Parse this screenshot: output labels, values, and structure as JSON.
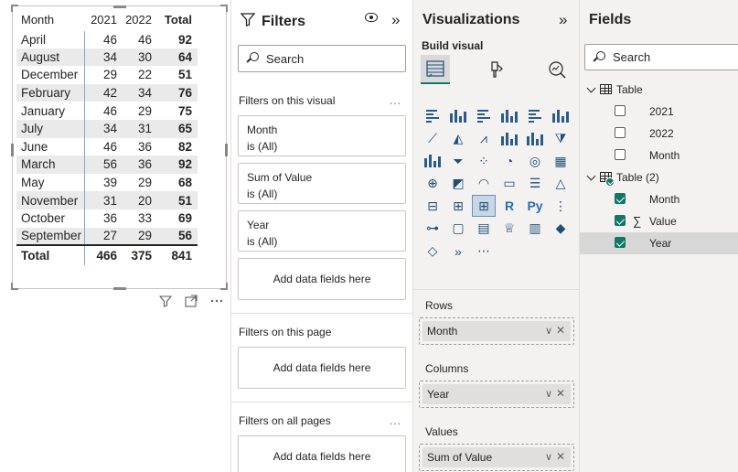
{
  "matrix": {
    "headers": {
      "month": "Month",
      "y2021": "2021",
      "y2022": "2022",
      "total": "Total"
    },
    "rows": [
      {
        "month": "April",
        "y2021": "46",
        "y2022": "46",
        "total": "92"
      },
      {
        "month": "August",
        "y2021": "34",
        "y2022": "30",
        "total": "64"
      },
      {
        "month": "December",
        "y2021": "29",
        "y2022": "22",
        "total": "51"
      },
      {
        "month": "February",
        "y2021": "42",
        "y2022": "34",
        "total": "76"
      },
      {
        "month": "January",
        "y2021": "46",
        "y2022": "29",
        "total": "75"
      },
      {
        "month": "July",
        "y2021": "34",
        "y2022": "31",
        "total": "65"
      },
      {
        "month": "June",
        "y2021": "46",
        "y2022": "36",
        "total": "82"
      },
      {
        "month": "March",
        "y2021": "56",
        "y2022": "36",
        "total": "92"
      },
      {
        "month": "May",
        "y2021": "39",
        "y2022": "29",
        "total": "68"
      },
      {
        "month": "November",
        "y2021": "31",
        "y2022": "20",
        "total": "51"
      },
      {
        "month": "October",
        "y2021": "36",
        "y2022": "33",
        "total": "69"
      },
      {
        "month": "September",
        "y2021": "27",
        "y2022": "29",
        "total": "56"
      }
    ],
    "totals": {
      "label": "Total",
      "y2021": "466",
      "y2022": "375",
      "total": "841"
    }
  },
  "visual_actions": {
    "filter_icon": "filter-icon",
    "focus_icon": "focus-mode-icon",
    "more_icon": "more-options-icon"
  },
  "filters": {
    "title": "Filters",
    "collapse": "»",
    "search_placeholder": "Search",
    "on_visual_label": "Filters on this visual",
    "on_page_label": "Filters on this page",
    "on_all_pages_label": "Filters on all pages",
    "more": "...",
    "cards": [
      {
        "field": "Month",
        "state": "is (All)"
      },
      {
        "field": "Sum of Value",
        "state": "is (All)"
      },
      {
        "field": "Year",
        "state": "is (All)"
      }
    ],
    "add_fields": "Add data fields here"
  },
  "visualizations": {
    "title": "Visualizations",
    "collapse": "»",
    "build_visual": "Build visual",
    "more_visuals": "...",
    "wells": {
      "rows_label": "Rows",
      "rows_field": "Month",
      "columns_label": "Columns",
      "columns_field": "Year",
      "values_label": "Values",
      "values_field": "Sum of Value"
    },
    "chevron": "∨",
    "remove": "✕"
  },
  "fields": {
    "title": "Fields",
    "search_placeholder": "Search",
    "tables": [
      {
        "name": "Table",
        "fields": [
          {
            "name": "2021",
            "checked": false
          },
          {
            "name": "2022",
            "checked": false
          },
          {
            "name": "Month",
            "checked": false
          }
        ]
      },
      {
        "name": "Table (2)",
        "fields": [
          {
            "name": "Month",
            "checked": true
          },
          {
            "name": "Value",
            "checked": true
          },
          {
            "name": "Year",
            "checked": true
          }
        ]
      }
    ]
  },
  "colors": {
    "accent": "#117865",
    "pane_bg": "#f3f2f1",
    "row_band": "#eaeaea"
  }
}
